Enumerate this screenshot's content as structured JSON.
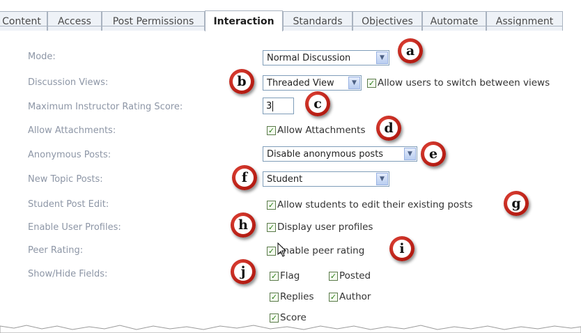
{
  "tabs": [
    {
      "label": "Content"
    },
    {
      "label": "Access"
    },
    {
      "label": "Post Permissions"
    },
    {
      "label": "Interaction",
      "active": true
    },
    {
      "label": "Standards"
    },
    {
      "label": "Objectives"
    },
    {
      "label": "Automate"
    },
    {
      "label": "Assignment"
    }
  ],
  "form": {
    "mode": {
      "label": "Mode:",
      "value": "Normal Discussion"
    },
    "views": {
      "label": "Discussion Views:",
      "value": "Threaded View",
      "checkbox_label": "Allow users to switch between views",
      "checked": true
    },
    "rating": {
      "label": "Maximum Instructor Rating Score:",
      "value": "3"
    },
    "attachments": {
      "label": "Allow Attachments:",
      "checkbox_label": "Allow Attachments",
      "checked": true
    },
    "anonymous": {
      "label": "Anonymous Posts:",
      "value": "Disable anonymous posts"
    },
    "new_topic": {
      "label": "New Topic Posts:",
      "value": "Student"
    },
    "post_edit": {
      "label": "Student Post Edit:",
      "checkbox_label": "Allow students to edit their existing posts",
      "checked": true
    },
    "profiles": {
      "label": "Enable User Profiles:",
      "checkbox_label": "Display user profiles",
      "checked": true
    },
    "peer": {
      "label": "Peer Rating:",
      "checkbox_label": "Enable peer rating",
      "checked": true
    },
    "fields": {
      "label": "Show/Hide Fields:",
      "flag": "Flag",
      "posted": "Posted",
      "replies": "Replies",
      "author": "Author",
      "score": "Score"
    }
  },
  "callouts": {
    "a": "a",
    "b": "b",
    "c": "c",
    "d": "d",
    "e": "e",
    "f": "f",
    "g": "g",
    "h": "h",
    "i": "i",
    "j": "j"
  },
  "colors": {
    "callout_red": "#c0271b",
    "label_gray": "#8d96a6",
    "checkbox_green": "#2d7d1a"
  }
}
